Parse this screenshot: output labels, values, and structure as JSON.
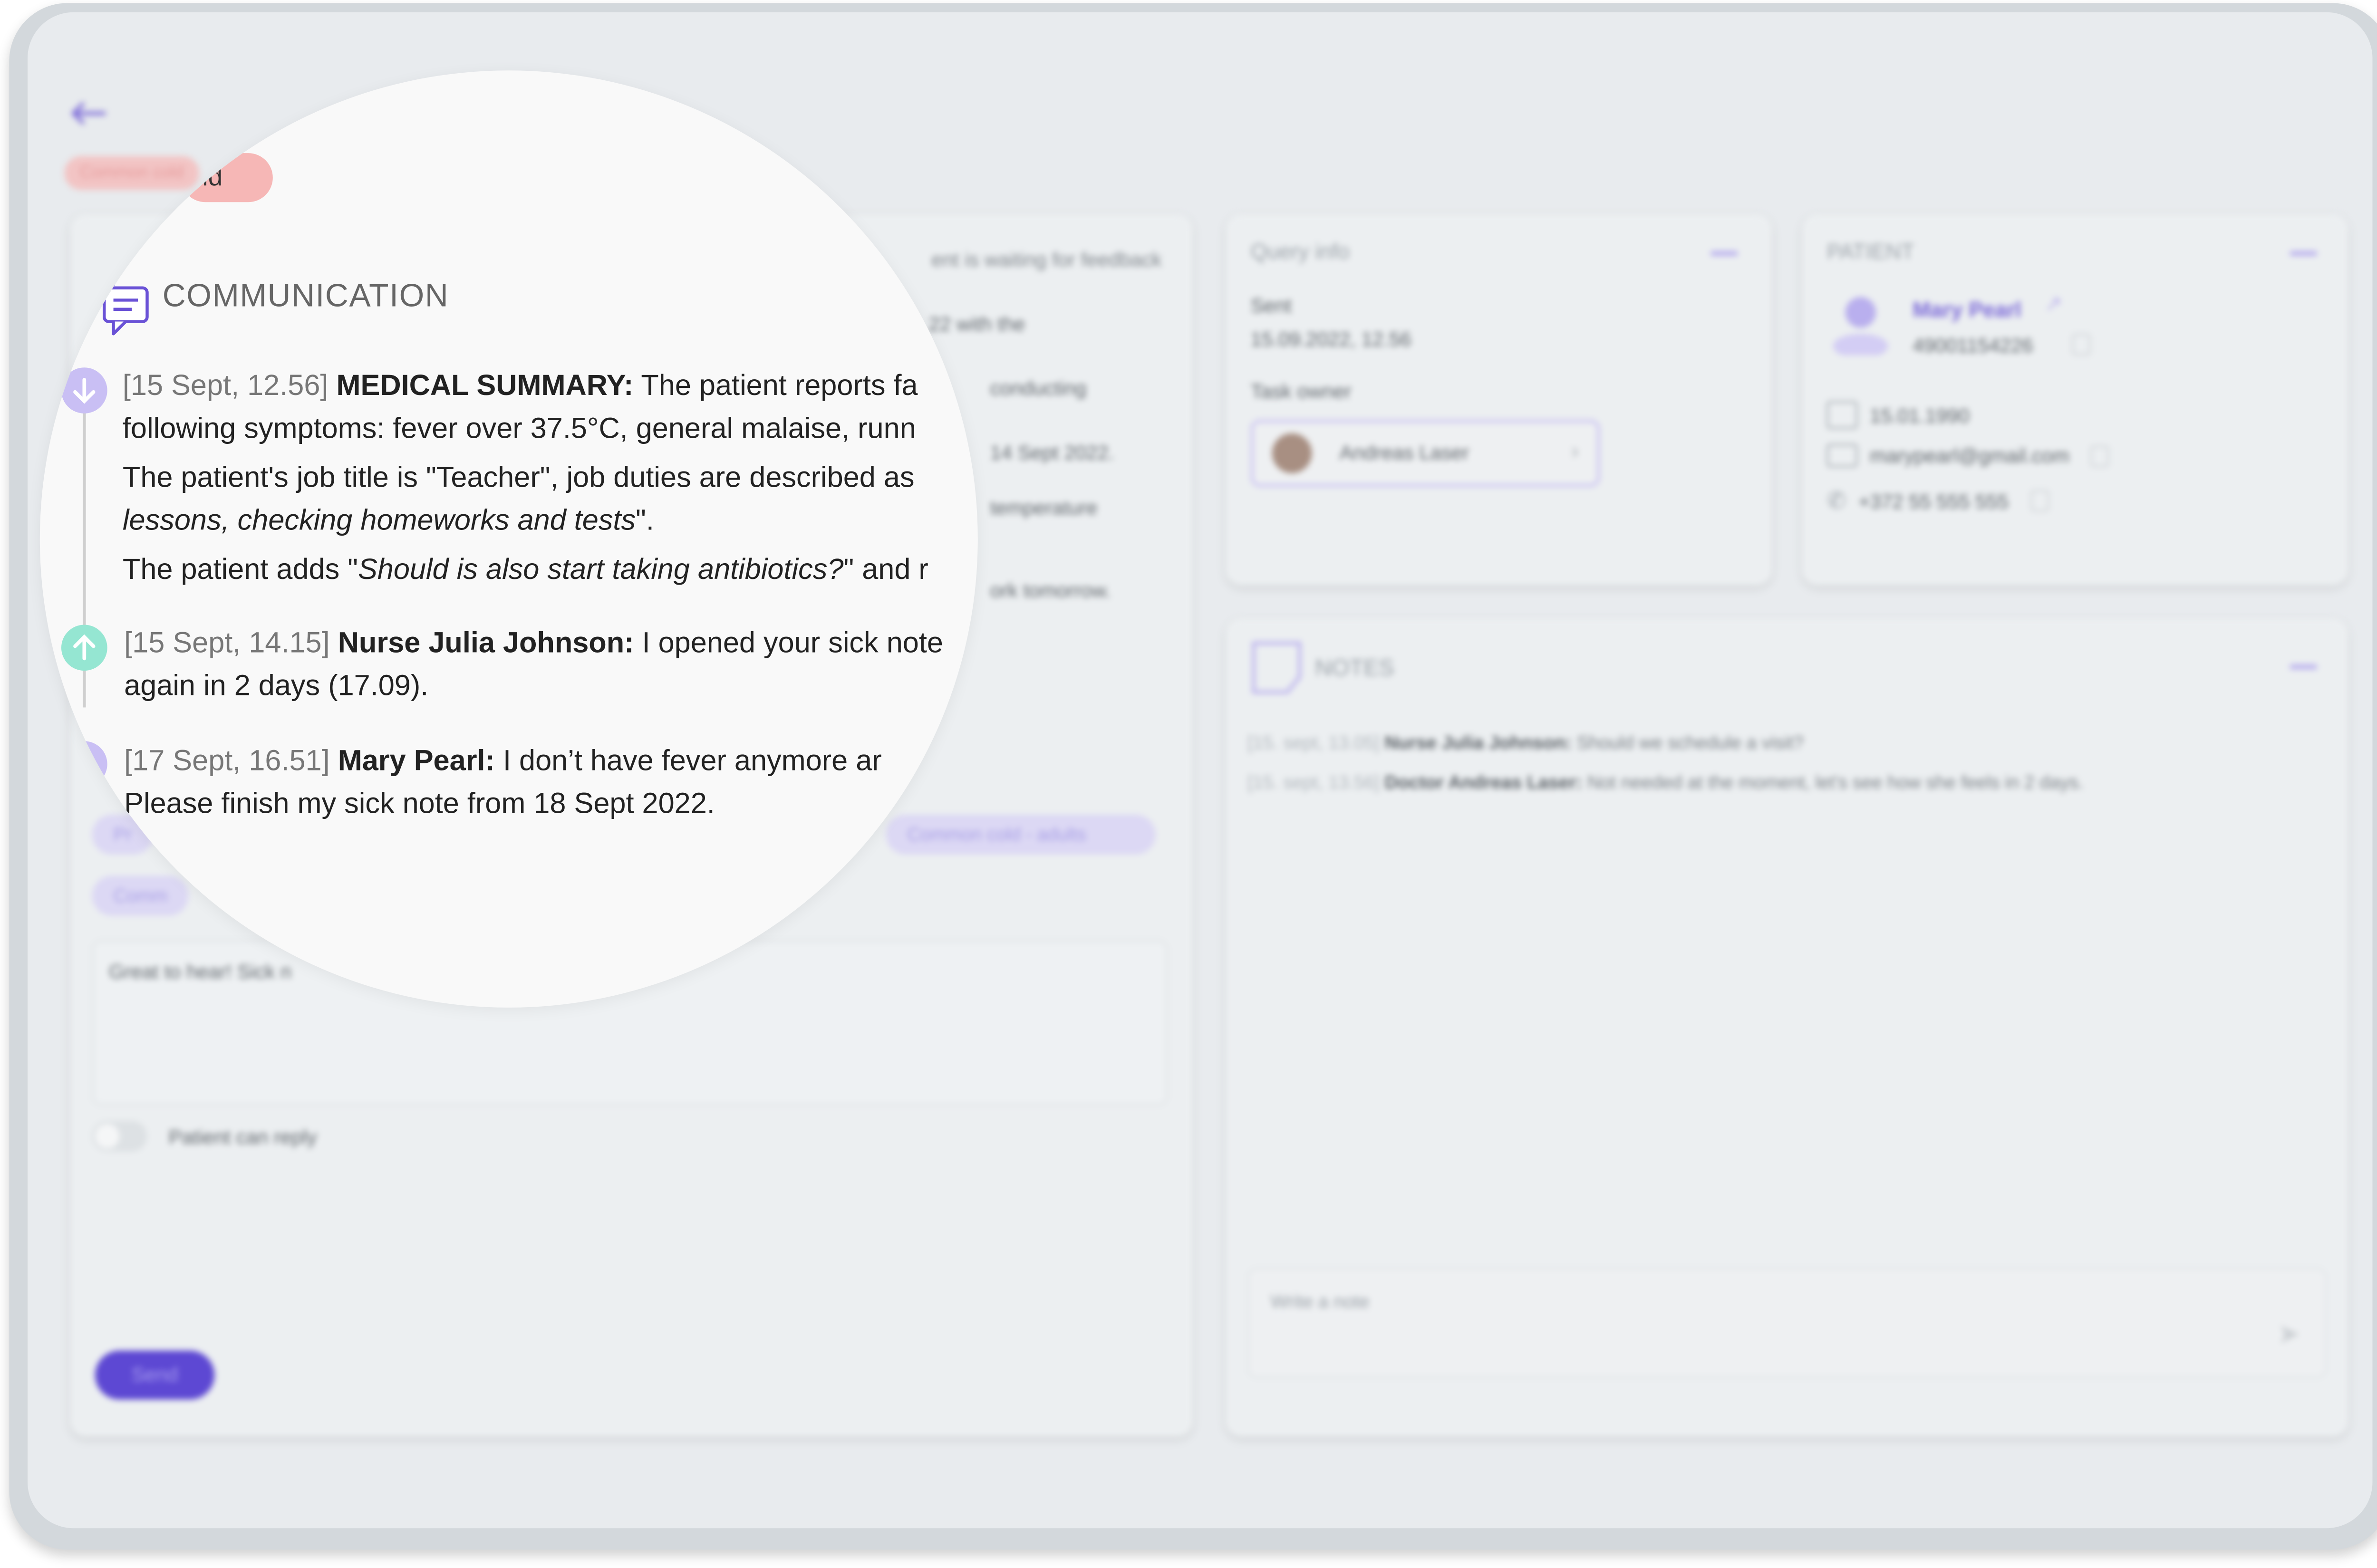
{
  "header": {
    "back_icon": "arrow-left-icon",
    "tag_blurred": "Common cold",
    "tag_lens_fragment": "ld"
  },
  "left_panel": {
    "status_text": "ent is waiting for feedback",
    "bg_fragments": [
      "22 with the",
      "conducting",
      "14 Sept 2022.",
      "temperature",
      "ork tomorrow."
    ],
    "chips": {
      "left_1": "Pr",
      "left_2": "Comm",
      "right": "Common cold - adults"
    },
    "reply_placeholder_start": "Great to hear! Sick n",
    "toggle_label": "Patient can reply",
    "send_button": "Send"
  },
  "communication": {
    "title": "COMMUNICATION",
    "icon": "chat-bubble-icon",
    "messages": [
      {
        "direction": "in",
        "timestamp": "[15 Sept, 12.56]",
        "author": "MEDICAL SUMMARY:",
        "line1": "The patient reports fa",
        "line2": "following symptoms: fever over 37.5°C, general malaise, runn",
        "line3": "The patient's job title is \"Teacher\", job duties are described as",
        "line4_italic": "lessons, checking homeworks and tests",
        "line4_end": "\".",
        "line5_start": "The patient adds \"",
        "line5_italic": "Should is also start taking antibiotics?",
        "line5_end": "\" and r"
      },
      {
        "direction": "out",
        "timestamp": "[15 Sept, 14.15]",
        "author": "Nurse Julia Johnson:",
        "line1": "I opened your sick note",
        "line2": "again in 2 days (17.09)."
      },
      {
        "direction": "in",
        "timestamp": "[17 Sept, 16.51]",
        "author": "Mary Pearl:",
        "line1": "I don’t have fever anymore ar",
        "line2": "Please finish my sick note from 18 Sept 2022."
      }
    ]
  },
  "query_info": {
    "title": "Query info",
    "sent_label": "Sent",
    "sent_value": "15.09.2022, 12.56",
    "owner_label": "Task owner",
    "owner_name": "Andreas Laser"
  },
  "patient": {
    "title": "PATIENT",
    "name": "Mary Pearl",
    "id_code": "49001154226",
    "birthdate": "15.01.1990",
    "email": "marypearl@gmail.com",
    "phone": "+372 55 555 555"
  },
  "notes": {
    "title": "NOTES",
    "entries": [
      {
        "time": "[15. sept, 13.05]",
        "author": "Nurse Julia Johnson:",
        "text": "Should we schedule a visit?"
      },
      {
        "time": "[15. sept, 13.56]",
        "author": "Doctor Andreas Laser:",
        "text": "Not needed at the moment, let's see how she feels in 2 days."
      }
    ],
    "input_placeholder": "Write a note"
  },
  "colors": {
    "accent": "#6a52d6",
    "incoming": "#c5baf3",
    "outgoing": "#8fe3cf",
    "tag": "#f4b8b8"
  }
}
